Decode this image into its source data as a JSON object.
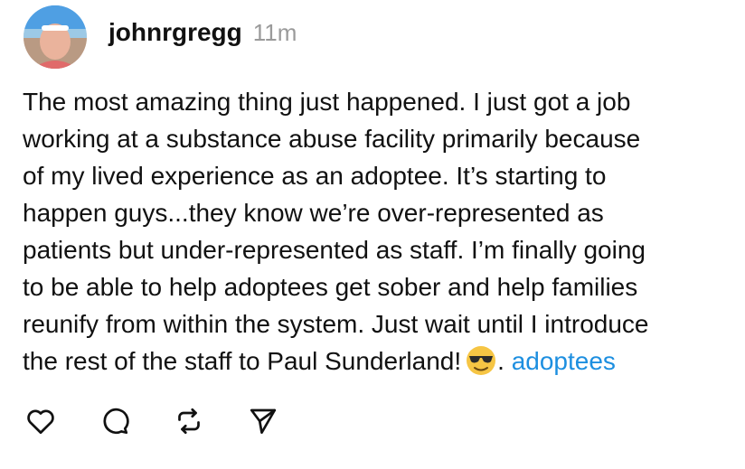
{
  "post": {
    "username": "johnrgregg",
    "time": "11m",
    "lines": [
      "The most amazing thing just happened. I just got a job",
      "working at a substance abuse facility primarily because",
      "of my lived experience as an adoptee. It’s starting to",
      "happen guys...they know we’re over-represented as",
      "patients but under-represented as staff. I’m finally going",
      "to be able to help adoptees get sober and help families",
      "reunify from within the system. Just wait until I introduce"
    ],
    "last_line": "the rest of the staff to Paul Sunderland!",
    "emoji": "smiling-face-with-sunglasses",
    "separator": ".",
    "hashtag": "adoptees"
  },
  "actions": {
    "icons": [
      "heart-icon",
      "comment-icon",
      "repost-icon",
      "share-icon"
    ]
  },
  "colors": {
    "text": "#111111",
    "muted": "#9a9a9a",
    "link": "#1d8fe0"
  }
}
